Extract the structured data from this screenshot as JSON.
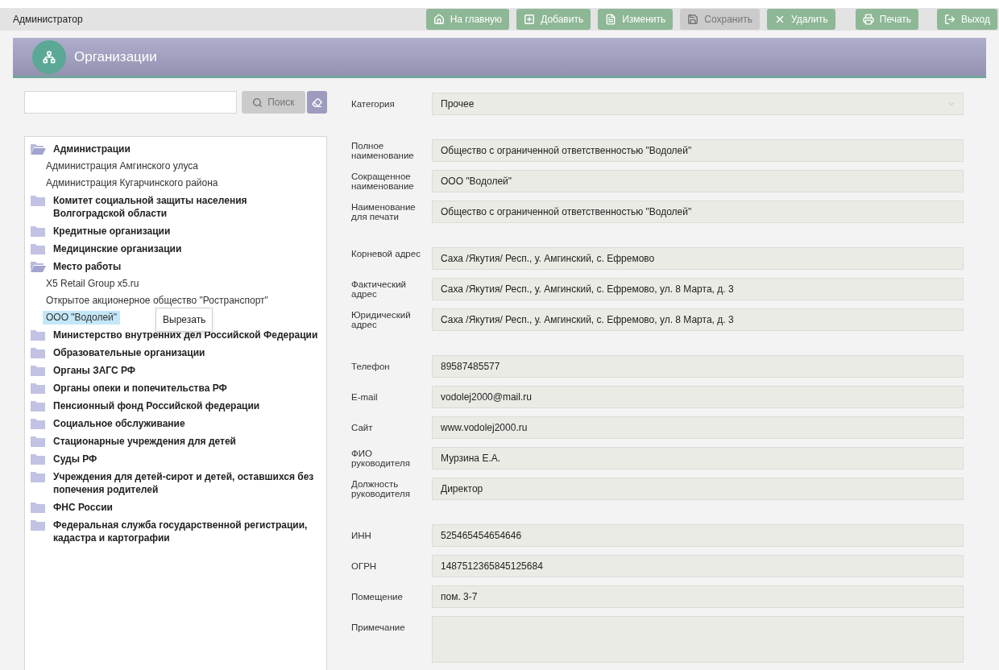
{
  "top_bar": {
    "user": "Администратор",
    "buttons": [
      {
        "kind": "home",
        "label": "На главную",
        "disabled": false
      },
      {
        "kind": "add",
        "label": "Добавить",
        "disabled": false
      },
      {
        "kind": "edit",
        "label": "Изменить",
        "disabled": false
      },
      {
        "kind": "save",
        "label": "Сохранить",
        "disabled": true
      },
      {
        "kind": "delete",
        "label": "Удалить",
        "disabled": false
      },
      {
        "kind": "print",
        "label": "Печать",
        "disabled": false
      },
      {
        "kind": "exit",
        "label": "Выход",
        "disabled": false
      }
    ]
  },
  "header": {
    "title": "Организации"
  },
  "search": {
    "button": "Поиск",
    "disabled": true
  },
  "tree": [
    {
      "label": "Администрации",
      "expanded": true,
      "children": [
        {
          "label": "Администрация Амгинского улуса",
          "selected": false
        },
        {
          "label": "Администрация Кугарчинского района",
          "selected": false
        }
      ]
    },
    {
      "label": "Комитет социальной защиты населения Волгоградской области",
      "expanded": false
    },
    {
      "label": "Кредитные организации",
      "expanded": false
    },
    {
      "label": "Медицинские организации",
      "expanded": false
    },
    {
      "label": "Место работы",
      "expanded": true,
      "children": [
        {
          "label": "X5 Retail Group x5.ru",
          "selected": false
        },
        {
          "label": "Открытое акционерное общество \"Ространспорт\"",
          "selected": false
        },
        {
          "label": "ООО \"Водолей\"",
          "selected": true
        }
      ]
    },
    {
      "label": "Министерство внутренних дел Российской Федерации",
      "expanded": false
    },
    {
      "label": "Образовательные организации",
      "expanded": false
    },
    {
      "label": "Органы ЗАГС РФ",
      "expanded": false
    },
    {
      "label": "Органы опеки и попечительства РФ",
      "expanded": false
    },
    {
      "label": "Пенсионный фонд Российской федерации",
      "expanded": false
    },
    {
      "label": "Социальное обслуживание",
      "expanded": false
    },
    {
      "label": "Стационарные учреждения для детей",
      "expanded": false
    },
    {
      "label": "Суды РФ",
      "expanded": false
    },
    {
      "label": "Учреждения для детей-сирот и детей, оставшихся без попечения родителей",
      "expanded": false
    },
    {
      "label": "ФНС России",
      "expanded": false
    },
    {
      "label": "Федеральная служба государственной регистрации, кадастра и картографии",
      "expanded": false
    }
  ],
  "context_menu": {
    "items": [
      "Вырезать"
    ]
  },
  "form_groups": [
    [
      {
        "kind": "select",
        "label": "Категория",
        "value": "Прочее"
      }
    ],
    [
      {
        "kind": "text",
        "label": "Полное наименование",
        "value": "Общество с ограниченной ответственностью \"Водолей\""
      },
      {
        "kind": "text",
        "label": "Сокращенное наименование",
        "value": "ООО \"Водолей\""
      },
      {
        "kind": "text",
        "label": "Наименование для печати",
        "value": "Общество с ограниченной ответственностью \"Водолей\""
      }
    ],
    [
      {
        "kind": "text",
        "label": "Корневой адрес",
        "value": "Саха /Якутия/ Респ., у. Амгинский, с. Ефремово"
      },
      {
        "kind": "text",
        "label": "Фактический адрес",
        "value": "Саха /Якутия/ Респ., у. Амгинский, с. Ефремово, ул. 8 Марта, д. 3"
      },
      {
        "kind": "text",
        "label": "Юридический адрес",
        "value": "Саха /Якутия/ Респ., у. Амгинский, с. Ефремово, ул. 8 Марта, д. 3"
      }
    ],
    [
      {
        "kind": "text",
        "label": "Телефон",
        "value": "89587485577"
      },
      {
        "kind": "text",
        "label": "E-mail",
        "value": "vodolej2000@mail.ru"
      },
      {
        "kind": "text",
        "label": "Сайт",
        "value": "www.vodolej2000.ru"
      },
      {
        "kind": "text",
        "label": "ФИО руководителя",
        "value": "Мурзина Е.А."
      },
      {
        "kind": "text",
        "label": "Должность руководителя",
        "value": "Директор"
      }
    ],
    [
      {
        "kind": "text",
        "label": "ИНН",
        "value": "525465454654646"
      },
      {
        "kind": "text",
        "label": "ОГРН",
        "value": "1487512365845125684"
      },
      {
        "kind": "text",
        "label": "Помещение",
        "value": "пом. 3-7"
      },
      {
        "kind": "textarea",
        "label": "Примечание"
      }
    ]
  ]
}
